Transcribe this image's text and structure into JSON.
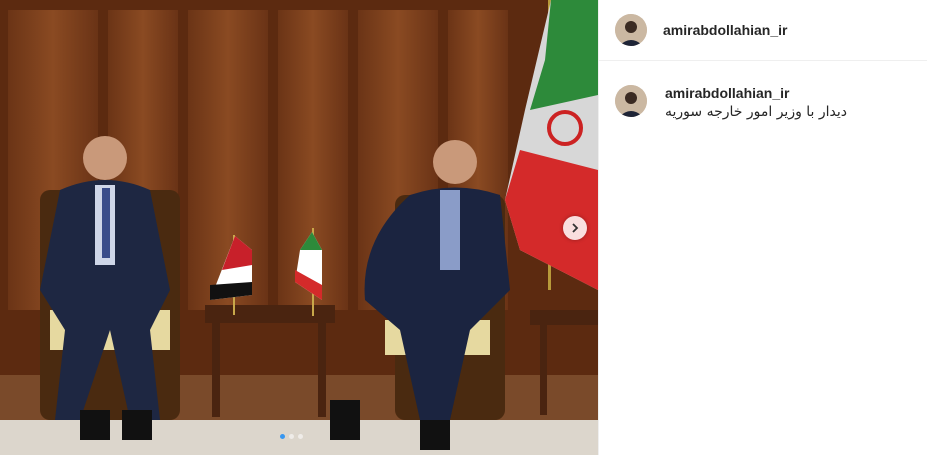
{
  "post": {
    "username": "amirabdollahian_ir",
    "caption_username": "amirabdollahian_ir",
    "caption": "دیدار با وزیر امور خارجه سوریه"
  },
  "carousel": {
    "dot_count": 3,
    "active_index": 0
  },
  "icons": {
    "next": "chevron-right-icon"
  },
  "colors": {
    "active_dot": "#3897f0",
    "text": "#262626",
    "divider": "#efefef"
  }
}
